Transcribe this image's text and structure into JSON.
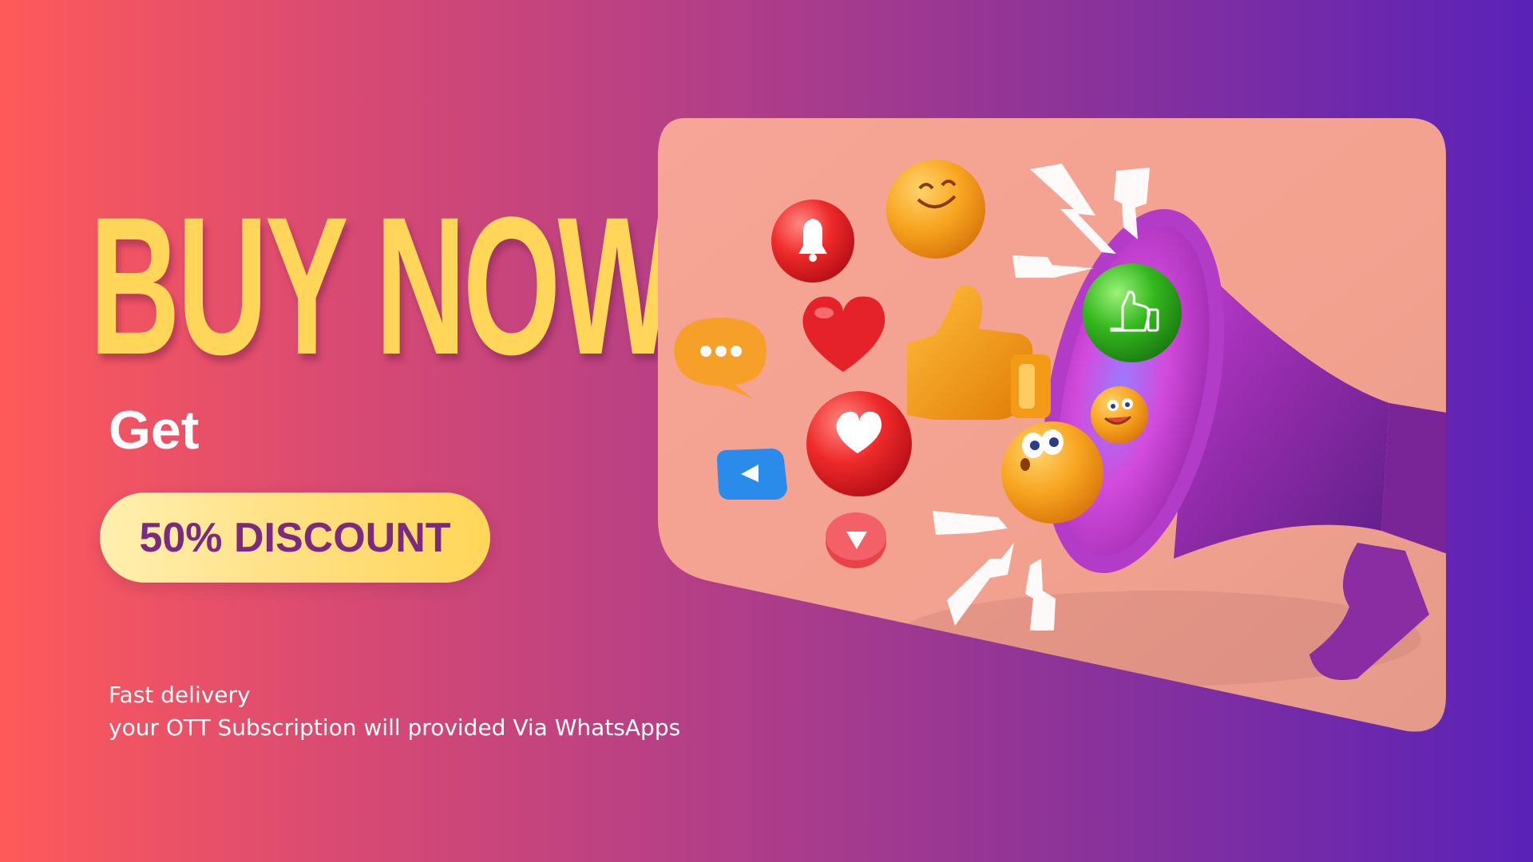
{
  "headline": "BUY NOW",
  "subhead": "Get",
  "discount_label": "50% DISCOUNT",
  "footnote": {
    "line1": "Fast delivery",
    "line2": "your OTT Subscription will provided Via WhatsApps"
  },
  "colors": {
    "gradient_start": "#fe5a5a",
    "gradient_end": "#5a22b8",
    "headline": "#ffd65a",
    "discount_text": "#7b2a80",
    "card_background": "#f6a393"
  },
  "illustration": {
    "subject": "megaphone-icon",
    "icons": [
      "bell-icon",
      "smiley-icon",
      "chat-bubble-icon",
      "heart-icon",
      "thumbs-up-icon",
      "like-ball-icon",
      "surprised-emoji-icon",
      "winking-emoji-icon",
      "play-button-icon",
      "lightning-icon"
    ]
  }
}
